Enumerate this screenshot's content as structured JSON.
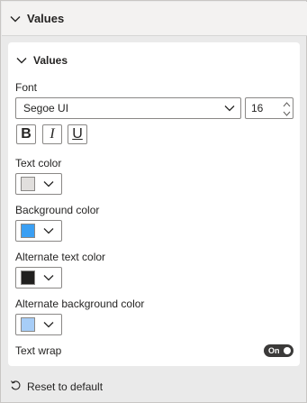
{
  "outer_section": {
    "title": "Values"
  },
  "card": {
    "title": "Values"
  },
  "font": {
    "label": "Font",
    "family": "Segoe UI",
    "size": "16"
  },
  "formatting": {
    "bold": "B",
    "italic": "I",
    "underline": "U"
  },
  "text_color": {
    "label": "Text color",
    "color": "#e1dfdd"
  },
  "background_color": {
    "label": "Background color",
    "color": "#3a9ff3"
  },
  "alt_text_color": {
    "label": "Alternate text color",
    "color": "#201f1e"
  },
  "alt_background_color": {
    "label": "Alternate background color",
    "color": "#a7cdf7"
  },
  "text_wrap": {
    "label": "Text wrap",
    "state": "On"
  },
  "footer": {
    "reset_label": "Reset to default"
  },
  "icons": {
    "collapse": "chevron-down-icon",
    "dropdown": "chevron-down-icon",
    "spin": "spin-arrows-icon",
    "reset": "undo-icon"
  }
}
